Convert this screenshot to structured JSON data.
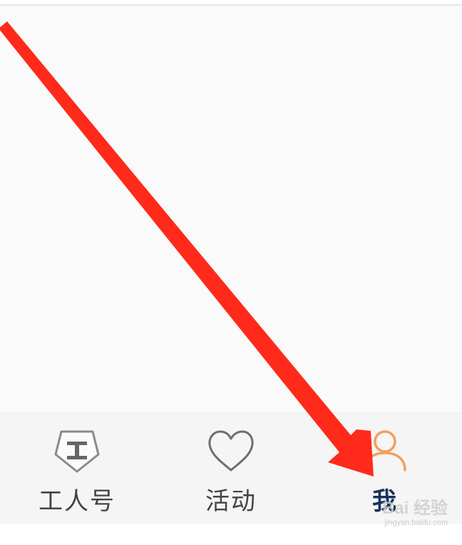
{
  "tab_bar": {
    "tabs": [
      {
        "label": "工人号",
        "icon": "gongrenhao-pentagon-icon",
        "active": false
      },
      {
        "label": "活动",
        "icon": "heart-outline-icon",
        "active": false
      },
      {
        "label": "我",
        "icon": "person-outline-icon",
        "active": true
      }
    ]
  },
  "annotation": {
    "arrow_color": "#ff2a1a"
  },
  "watermark": {
    "main": "Bai 经验",
    "sub": "jingyan.baidu.com"
  },
  "colors": {
    "active_icon": "#f0a060",
    "active_label": "#16325f",
    "inactive": "#555555"
  }
}
